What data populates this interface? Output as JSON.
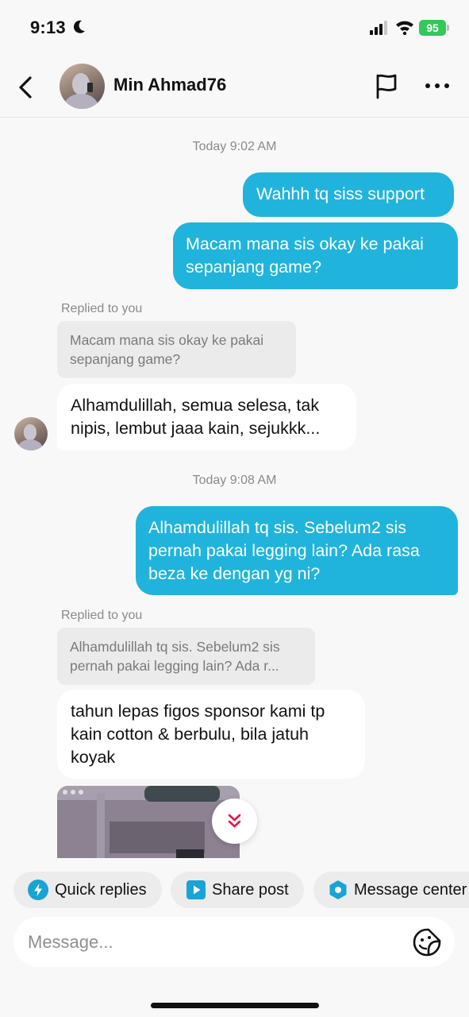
{
  "status_bar": {
    "time": "9:13",
    "battery": "95"
  },
  "header": {
    "contact_name": "Min Ahmad76"
  },
  "icons": [
    "moon-icon",
    "signal-icon",
    "wifi-icon",
    "back-icon",
    "flag-icon",
    "more-icon",
    "chevrons-down-icon",
    "bolt-icon",
    "play-icon",
    "hexagon-icon",
    "sticker-icon"
  ],
  "colors": {
    "sent_bubble": "#20b4dc",
    "background": "#f8f8f8",
    "chip": "#ececec",
    "accent_icon": "#1aa3d6",
    "scroll_chevron": "#e8174e"
  },
  "chat": {
    "timestamp_1": "Today 9:02 AM",
    "sent_1_line_1": "Wahhh tq siss support",
    "sent_2_line_1": "Macam mana sis okay ke pakai",
    "sent_2_line_2": "sepanjang game?",
    "replied_label_1": "Replied to you",
    "quote_1_line_1": "Macam mana sis okay ke pakai",
    "quote_1_line_2": "sepanjang game?",
    "received_1_line_1": "Alhamdulillah, semua selesa, tak",
    "received_1_line_2": "nipis, lembut jaaa kain, sejukkk...",
    "timestamp_2": "Today 9:08 AM",
    "sent_3_line_1": "Alhamdulillah tq sis. Sebelum2 sis",
    "sent_3_line_2": "pernah pakai legging lain? Ada rasa",
    "sent_3_line_3": "beza ke dengan yg ni?",
    "replied_label_2": "Replied to you",
    "quote_2_line_1": "Alhamdulillah tq sis. Sebelum2 sis",
    "quote_2_line_2": "pernah pakai legging lain? Ada r...",
    "received_2_line_1": "tahun lepas figos sponsor kami tp",
    "received_2_line_2": "kain cotton & berbulu, bila jatuh",
    "received_2_line_3": "koyak"
  },
  "quick_actions": {
    "quick_replies": "Quick replies",
    "share_post": "Share post",
    "message_center": "Message center"
  },
  "input": {
    "placeholder": "Message..."
  }
}
